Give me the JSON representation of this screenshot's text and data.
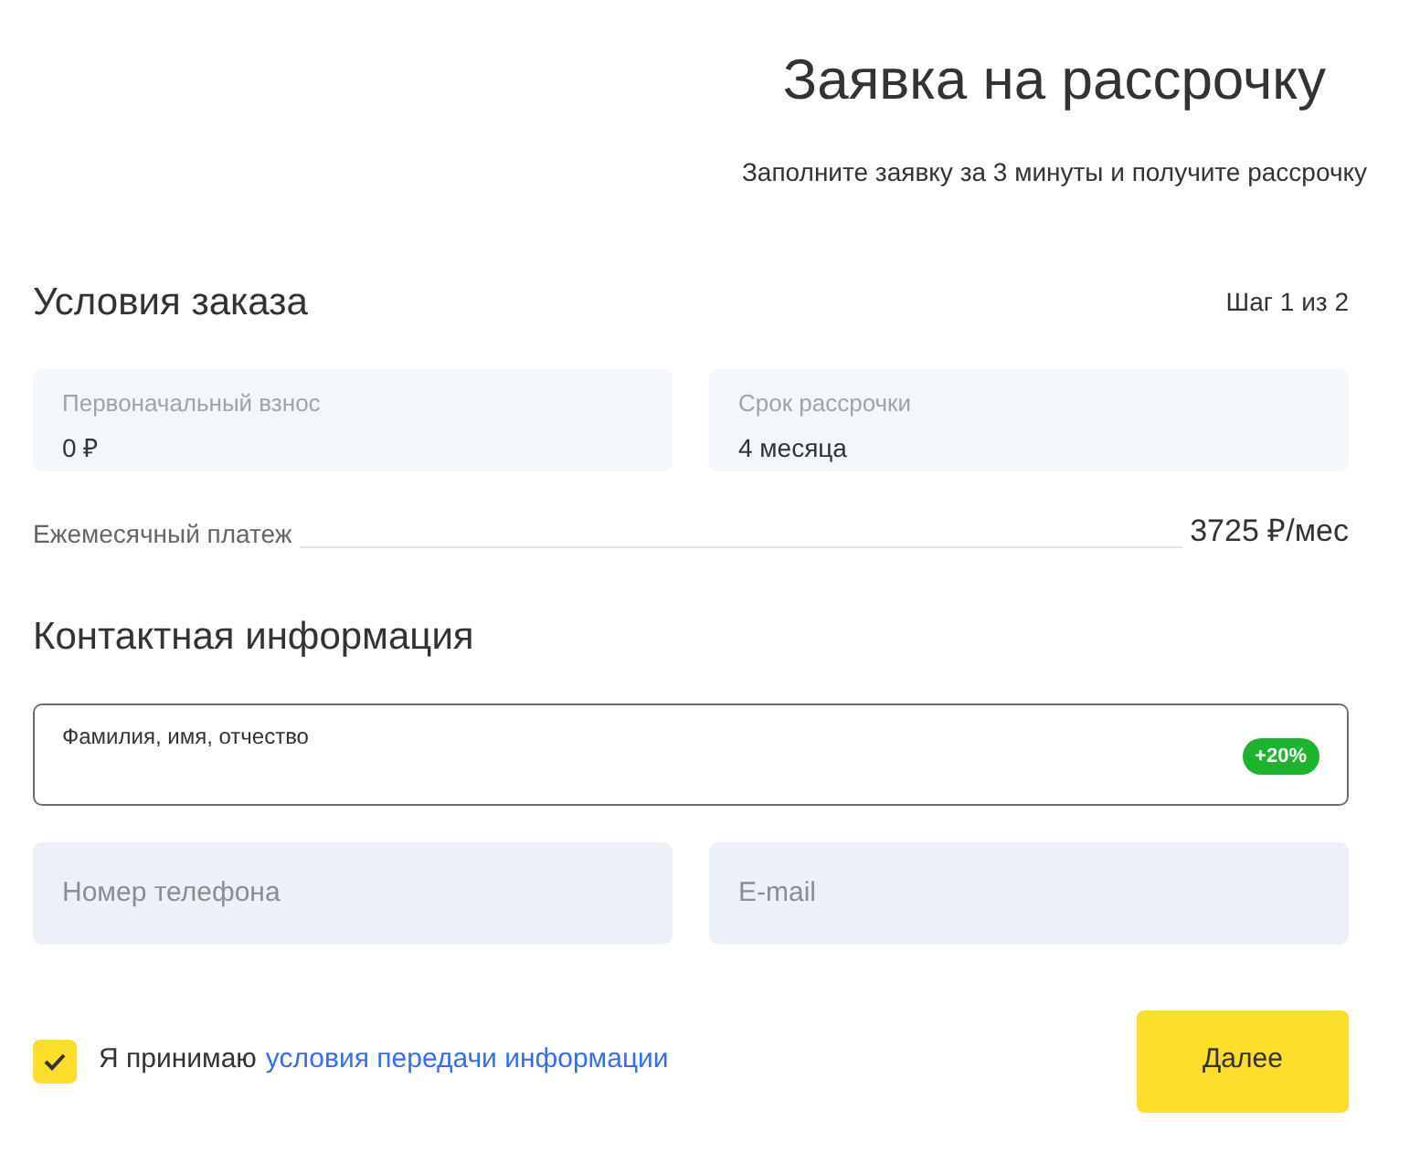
{
  "header": {
    "title": "Заявка на рассрочку",
    "subtitle": "Заполните заявку за 3 минуты и получите рассрочку"
  },
  "order": {
    "title": "Условия заказа",
    "step": "Шаг 1 из 2",
    "fields": [
      {
        "label": "Первоначальный взнос",
        "value": "0 ₽"
      },
      {
        "label": "Срок рассрочки",
        "value": "4 месяца"
      }
    ],
    "payment": {
      "label": "Ежемесячный платеж",
      "value": "3725 ₽/мес"
    }
  },
  "contact": {
    "title": "Контактная информация",
    "name_field": {
      "label": "Фамилия, имя, отчество",
      "badge": "+20%"
    },
    "fields": [
      {
        "placeholder": "Номер телефона"
      },
      {
        "placeholder": "E-mail"
      }
    ]
  },
  "consent": {
    "checked": true,
    "text": "Я принимаю",
    "link": "условия передачи информации"
  },
  "button": "Далее"
}
